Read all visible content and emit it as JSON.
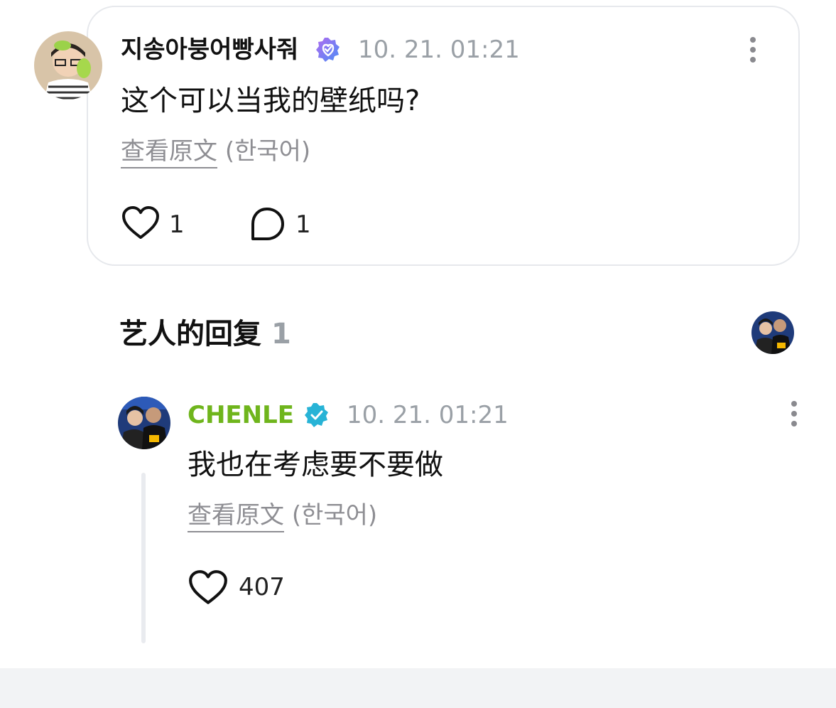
{
  "comment": {
    "username": "지송아붕어빵사줘",
    "timestamp": "10. 21. 01:21",
    "text": "这个可以当我的壁纸吗?",
    "translate_link": "查看原文",
    "translate_lang": "(한국어)",
    "like_count": "1",
    "reply_count": "1"
  },
  "artist_replies": {
    "title": "艺人的回复",
    "count": "1"
  },
  "reply": {
    "username": "CHENLE",
    "timestamp": "10. 21. 01:21",
    "text": "我也在考虑要不要做",
    "translate_link": "查看原文",
    "translate_lang": "(한국어)",
    "like_count": "407"
  },
  "colors": {
    "artist_name": "#6fb51c",
    "verified_fan": "#8a6cf0",
    "verified_artist": "#27b3d6",
    "muted_text": "#9aa0a6"
  },
  "icons": {
    "like": "heart-outline-icon",
    "reply": "chat-bubble-icon",
    "more": "more-vertical-icon",
    "fan_badge": "heart-check-badge-icon",
    "artist_badge": "verified-check-badge-icon"
  }
}
